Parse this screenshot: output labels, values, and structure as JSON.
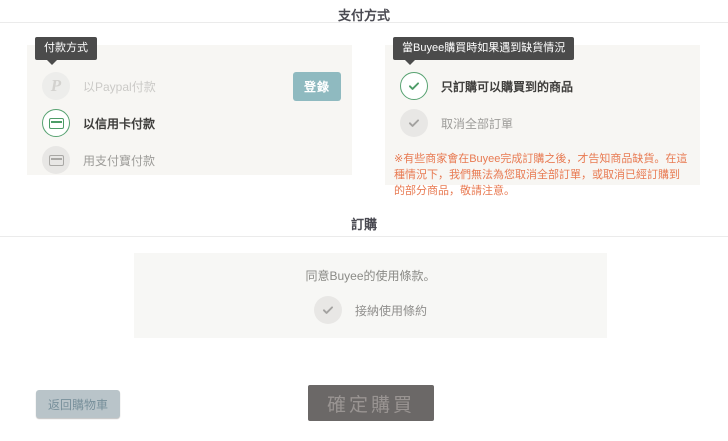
{
  "sections": {
    "payment_title": "支付方式",
    "order_title": "訂購"
  },
  "payment_panel": {
    "tag": "付款方式",
    "login_button": "登錄",
    "options": [
      {
        "label": "以Paypal付款",
        "state": "disabled",
        "icon": "paypal-icon"
      },
      {
        "label": "以信用卡付款",
        "state": "selected",
        "icon": "credit-card-icon"
      },
      {
        "label": "用支付寶付款",
        "state": "unselected",
        "icon": "credit-card-icon"
      }
    ]
  },
  "stock_panel": {
    "tag": "當Buyee購買時如果遇到缺貨情況",
    "options": [
      {
        "label": "只訂購可以購買到的商品",
        "state": "selected",
        "icon": "check-icon"
      },
      {
        "label": "取消全部訂單",
        "state": "unselected",
        "icon": "check-icon"
      }
    ],
    "notice": "※有些商家會在Buyee完成訂購之後，才告知商品缺貨。在這種情況下，我們無法為您取消全部訂單，或取消已經訂購到的部分商品，敬請注意。"
  },
  "agreement": {
    "text": "同意Buyee的使用條款。",
    "checkbox_label": "接納使用條約",
    "checkbox_state": "unselected"
  },
  "footer": {
    "back_button": "返回購物車",
    "confirm_button": "確定購買"
  },
  "icons": {
    "paypal": "P",
    "check": "✓"
  },
  "colors": {
    "tag_bg": "#4b4b4b",
    "panel_bg": "#f7f6f3",
    "green": "#4d9c67",
    "teal_button": "#8fbac0",
    "notice_orange": "#e87a52",
    "confirm_bg": "#6b6867",
    "back_bg": "#b9c4c9"
  }
}
